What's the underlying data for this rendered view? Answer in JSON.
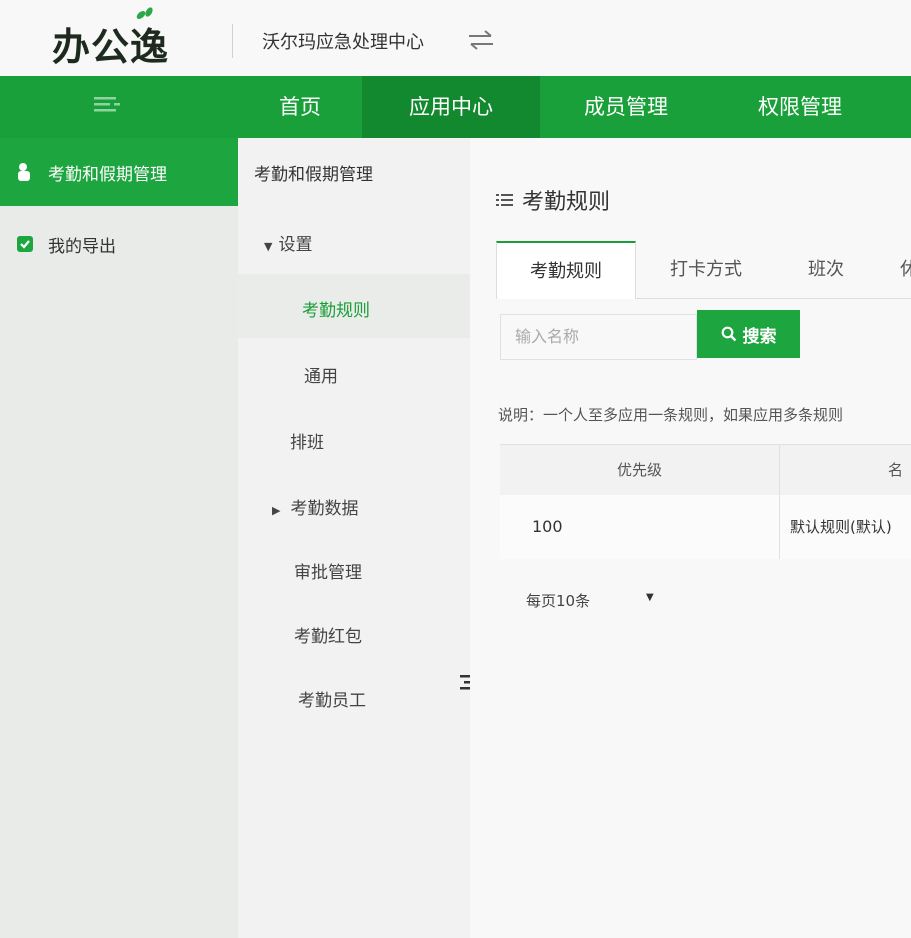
{
  "header": {
    "logo_text": "办公逸",
    "org_name": "沃尔玛应急处理中心"
  },
  "nav": {
    "items": [
      {
        "label": "首页"
      },
      {
        "label": "应用中心"
      },
      {
        "label": "成员管理"
      },
      {
        "label": "权限管理"
      }
    ],
    "active": "应用中心"
  },
  "sidebar": {
    "items": [
      {
        "label": "考勤和假期管理",
        "icon": "hand-icon"
      },
      {
        "label": "我的导出",
        "icon": "check-icon"
      }
    ]
  },
  "submenu": {
    "title": "考勤和假期管理",
    "settings_label": "设置",
    "items": [
      {
        "label": "考勤规则"
      },
      {
        "label": "通用"
      },
      {
        "label": "排班"
      },
      {
        "label": "考勤数据"
      },
      {
        "label": "审批管理"
      },
      {
        "label": "考勤红包"
      },
      {
        "label": "考勤员工"
      }
    ]
  },
  "main": {
    "title": "考勤规则",
    "tabs": [
      {
        "label": "考勤规则"
      },
      {
        "label": "打卡方式"
      },
      {
        "label": "班次"
      },
      {
        "label": "休"
      }
    ],
    "search": {
      "placeholder": "输入名称",
      "button_label": "搜索"
    },
    "note": "说明：一个人至多应用一条规则，如果应用多条规则",
    "table": {
      "headers": [
        "优先级",
        "名"
      ],
      "rows": [
        [
          "100",
          "默认规则(默认)"
        ]
      ]
    },
    "pager": {
      "page_size_label": "每页10条"
    }
  },
  "colors": {
    "brand_green": "#19a03a",
    "nav_active": "#13892f"
  }
}
